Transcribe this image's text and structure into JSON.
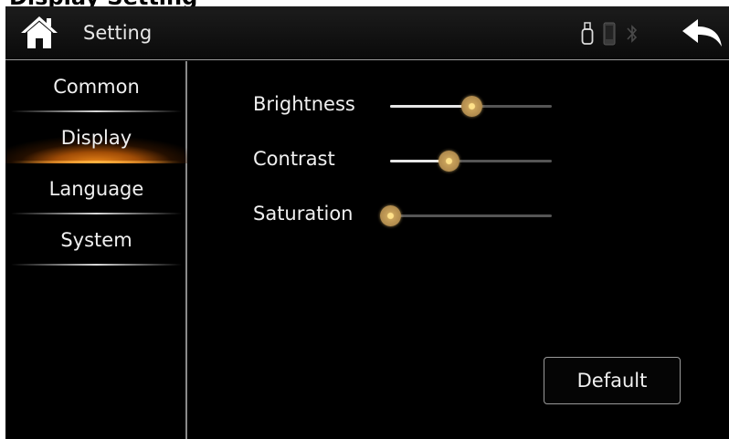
{
  "caption": "Display Setting",
  "header": {
    "title": "Setting",
    "home_icon": "home-icon",
    "back_icon": "back-arrow-icon",
    "status_icons": [
      "usb-icon",
      "phone-icon",
      "bluetooth-icon"
    ]
  },
  "sidebar": {
    "items": [
      {
        "label": "Common",
        "active": false
      },
      {
        "label": "Display",
        "active": true
      },
      {
        "label": "Language",
        "active": false
      },
      {
        "label": "System",
        "active": false
      }
    ]
  },
  "display": {
    "sliders": [
      {
        "label": "Brightness",
        "value": 0.5
      },
      {
        "label": "Contrast",
        "value": 0.36
      },
      {
        "label": "Saturation",
        "value": 0.0
      }
    ],
    "default_label": "Default"
  },
  "colors": {
    "accent": "#f08a1a",
    "thumb": "#c8a15a",
    "background": "#000000"
  }
}
